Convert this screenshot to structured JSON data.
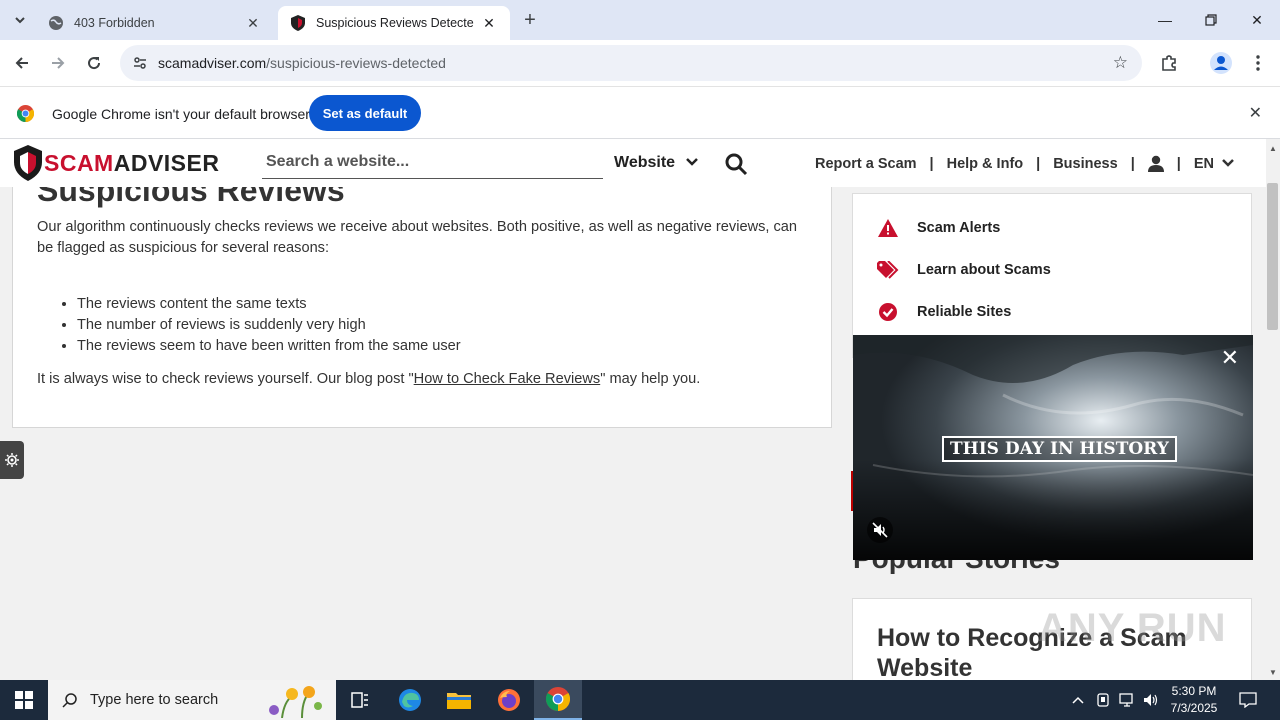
{
  "browser": {
    "tabs": [
      {
        "title": "403 Forbidden",
        "active": false
      },
      {
        "title": "Suspicious Reviews Detected - S",
        "active": true
      }
    ],
    "url_host": "scamadviser.com",
    "url_path": "/suspicious-reviews-detected"
  },
  "infobar": {
    "message": "Google Chrome isn't your default browser",
    "button": "Set as default"
  },
  "site": {
    "logo_scam": "SCAM",
    "logo_adviser": "ADVISER",
    "search_placeholder": "Search a website...",
    "search_type": "Website",
    "nav": [
      "Report a Scam",
      "Help & Info",
      "Business"
    ],
    "lang": "EN"
  },
  "article": {
    "heading": "Suspicious Reviews",
    "para1": "Our algorithm continuously checks reviews we receive about websites. Both positive, as well as negative reviews, can be flagged as suspicious for several reasons:",
    "bullets": [
      "The reviews content the same texts",
      "The number of reviews is suddenly very high",
      "The reviews seem to have been written from the same user"
    ],
    "para2_before": "It is always wise to check reviews yourself. Our blog post \"",
    "para2_link": "How to Check Fake Reviews",
    "para2_after": "\" may help you."
  },
  "sidebar": {
    "items": [
      "Scam Alerts",
      "Learn about Scams",
      "Reliable Sites"
    ],
    "popular_heading": "Popular Stories",
    "story_title": "How to Recognize a Scam Website"
  },
  "video": {
    "title": "THIS DAY IN HISTORY"
  },
  "watermark": "ANY RUN",
  "taskbar": {
    "search_placeholder": "Type here to search",
    "time": "5:30 PM",
    "date": "7/3/2025"
  },
  "colors": {
    "brand_red": "#c8102e",
    "chrome_blue": "#0b57d0",
    "taskbar": "#1c2a3c"
  }
}
